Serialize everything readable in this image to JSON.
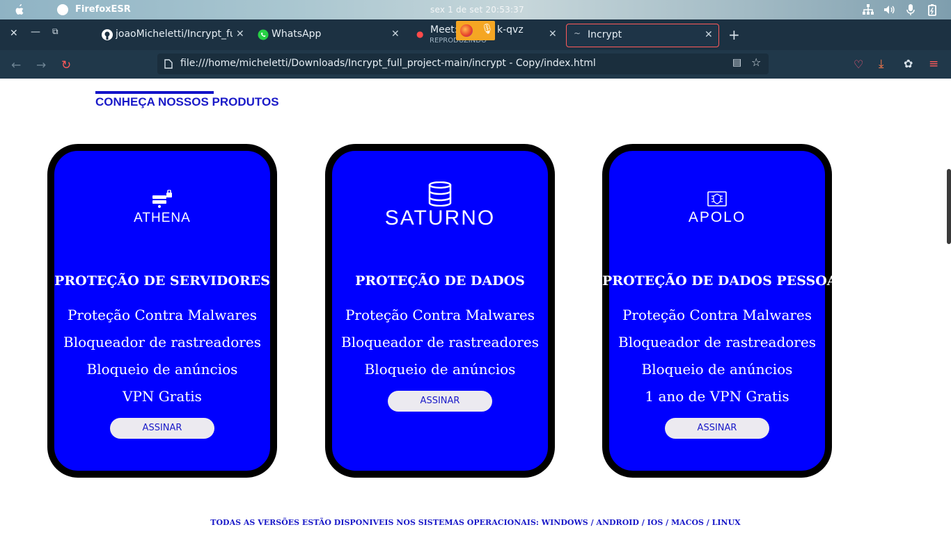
{
  "system_bar": {
    "app_name": "FirefoxESR",
    "clock": "sex 1 de set  20:53:37"
  },
  "tabs": [
    {
      "label": "joaoMicheletti/Incrypt_fu",
      "icon": "github-icon"
    },
    {
      "label": "WhatsApp",
      "icon": "whatsapp-icon"
    },
    {
      "label": "Meet:",
      "sublabel": "REPRODUZINDO",
      "trailing": "k-qvz",
      "icon": "meet-icon"
    },
    {
      "label": "Incrypt",
      "icon": "loading-icon"
    }
  ],
  "url": "file:///home/micheletti/Downloads/Incrypt_full_project-main/incrypt - Copy/index.html",
  "section": {
    "heading": "CONHEÇA NOSSOS PRODUTOS"
  },
  "products": [
    {
      "name": "ATHENA",
      "title": "PROTEÇÃO DE SERVIDORES",
      "features": [
        "Proteção Contra Malwares",
        "Bloqueador de rastreadores",
        "Bloqueio de anúncios",
        "VPN Gratis"
      ],
      "button": "ASSINAR"
    },
    {
      "name": "SATURNO",
      "title": "PROTEÇÃO DE DADOS",
      "features": [
        "Proteção Contra Malwares",
        "Bloqueador de rastreadores",
        "Bloqueio de anúncios"
      ],
      "button": "ASSINAR"
    },
    {
      "name": "APOLO",
      "title": "PROTEÇÃO DE DADOS PESSOAIS",
      "features": [
        "Proteção Contra Malwares",
        "Bloqueador de rastreadores",
        "Bloqueio de anúncios",
        "1 ano de VPN Gratis"
      ],
      "button": "ASSINAR"
    }
  ],
  "footer": "TODAS AS VERSÕES ESTÃO DISPONIVEIS NOS SISTEMAS OPERACIONAIS: WINDOWS / ANDROID / IOS / MACOS / LINUX",
  "colors": {
    "card": "#0000ff",
    "accent": "#1a1ac8",
    "tabbar": "#1c3142",
    "navbar": "#20384a"
  }
}
